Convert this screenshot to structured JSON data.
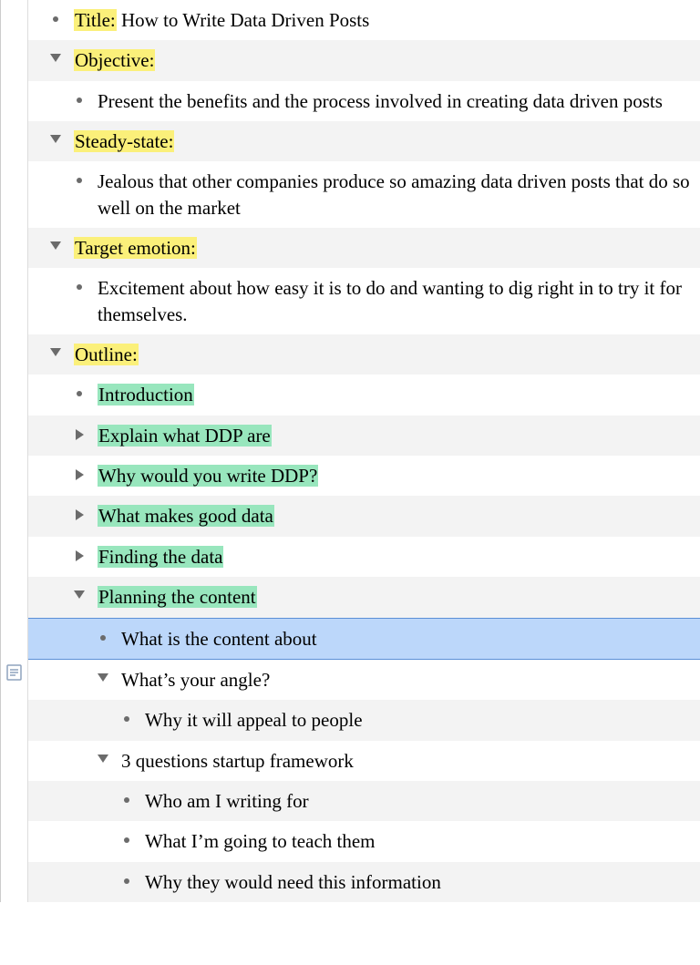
{
  "title_label": "Title:",
  "title_text": " How to Write Data Driven Posts",
  "objective_label": "Objective:",
  "objective_text": "Present the benefits and the process involved in creating data driven posts",
  "steady_label": "Steady-state:",
  "steady_text": "Jealous that other companies produce so amazing data driven posts that do so well on the market",
  "target_label": "Target emotion:",
  "target_text": "Excitement about how easy it is to do and wanting to dig right in to try it for themselves.",
  "outline_label": "Outline:",
  "outline": {
    "intro": "Introduction",
    "explain": "Explain what DDP are",
    "why": "Why would you write DDP?",
    "gooddata": "What makes good data",
    "finding": "Finding the data",
    "planning": "Planning the content",
    "planning_children": {
      "about": "What is the content about",
      "angle": "What’s your angle?",
      "angle_child": "Why it will appeal to people",
      "framework": "3 questions startup framework",
      "framework_children": {
        "who": "Who am I writing for",
        "teach": "What I’m going to teach them",
        "need": "Why they would need this information"
      }
    }
  }
}
